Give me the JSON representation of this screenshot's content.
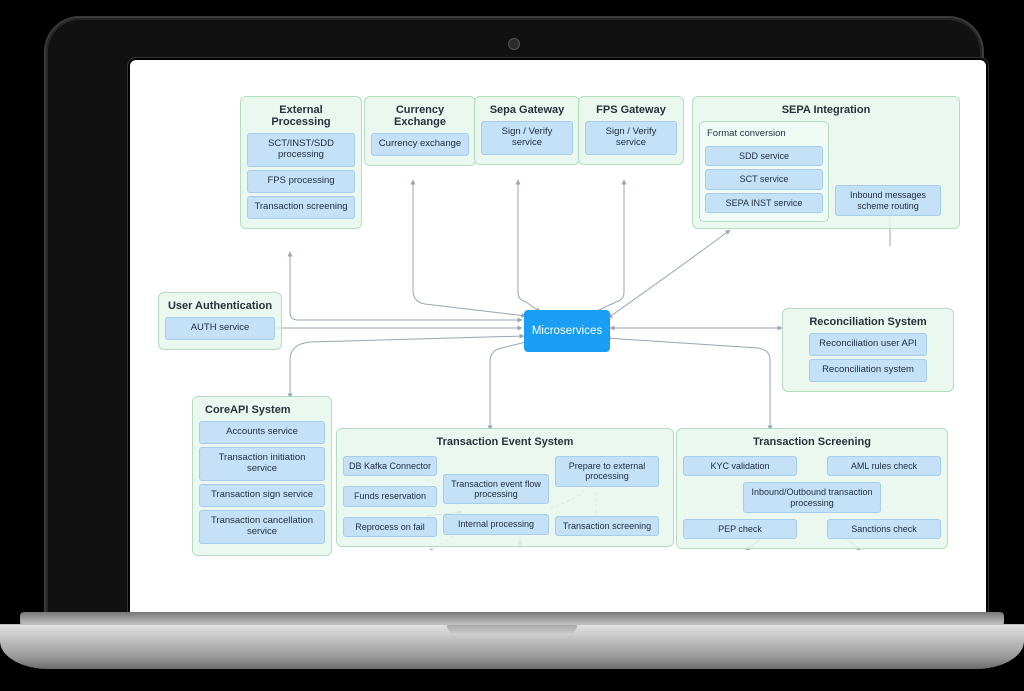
{
  "center": {
    "label": "Microservices"
  },
  "groups": {
    "extproc": {
      "title": "External Processing",
      "services": [
        "SCT/INST/SDD processing",
        "FPS processing",
        "Transaction screening"
      ]
    },
    "currency": {
      "title": "Currency Exchange",
      "services": [
        "Currency exchange"
      ]
    },
    "sepa_gw": {
      "title": "Sepa Gateway",
      "services": [
        "Sign / Verify service"
      ]
    },
    "fps_gw": {
      "title": "FPS Gateway",
      "services": [
        "Sign / Verify service"
      ]
    },
    "sepa_int": {
      "title": "SEPA Integration",
      "fmt_label": "Format conversion",
      "fmt_services": [
        "SDD service",
        "SCT service",
        "SEPA INST service"
      ],
      "routing": "Inbound messages scheme routing"
    },
    "auth": {
      "title": "User Authentication",
      "services": [
        "AUTH service"
      ]
    },
    "recon": {
      "title": "Reconciliation System",
      "services": [
        "Reconciliation user API",
        "Reconciliation system"
      ]
    },
    "coreapi": {
      "title": "CoreAPI System",
      "services": [
        "Accounts service",
        "Transaction initiation service",
        "Transaction sign service",
        "Transaction cancellation service"
      ]
    },
    "tes": {
      "title": "Transaction Event System",
      "items": {
        "db": "DB Kafka Connector",
        "funds": "Funds reservation",
        "reproc": "Reprocess on fail",
        "flow": "Transaction event flow processing",
        "internal": "Internal processing",
        "prep": "Prepare to external processing",
        "scr": "Transaction screening"
      }
    },
    "ts": {
      "title": "Transaction Screening",
      "items": {
        "kyc": "KYC validation",
        "aml": "AML rules check",
        "io": "Inbound/Outbound transaction processing",
        "pep": "PEP check",
        "sanc": "Sanctions check"
      }
    }
  }
}
